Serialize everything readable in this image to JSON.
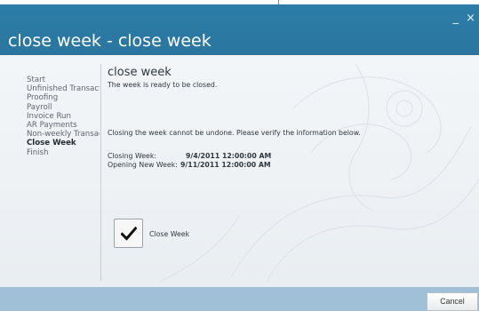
{
  "window": {
    "title": "close week - close week",
    "minimize_glyph": "_",
    "close_glyph": "×"
  },
  "nav": {
    "items": [
      {
        "label": "Start",
        "active": false
      },
      {
        "label": "Unfinished Transactions",
        "active": false
      },
      {
        "label": "Proofing",
        "active": false
      },
      {
        "label": "Payroll",
        "active": false
      },
      {
        "label": "Invoice Run",
        "active": false
      },
      {
        "label": "AR Payments",
        "active": false
      },
      {
        "label": "Non-weekly Transactions",
        "active": false
      },
      {
        "label": "Close Week",
        "active": true
      },
      {
        "label": "Finish",
        "active": false
      }
    ]
  },
  "content": {
    "heading": "close week",
    "ready_text": "The week is ready to be closed.",
    "warning_text": "Closing the week cannot be undone. Please verify the information below.",
    "closing_week_label": "Closing Week:",
    "closing_week_value": "9/4/2011 12:00:00 AM",
    "opening_week_label": "Opening New Week:",
    "opening_week_value": "9/11/2011 12:00:00 AM",
    "close_week_button_label": "Close Week"
  },
  "footer": {
    "cancel_label": "Cancel"
  },
  "icons": {
    "close_week_button": "checkmark-icon"
  },
  "colors": {
    "titlebar": "#2c7ea8",
    "footer": "#9fc0d6",
    "body": "#eef2f5"
  }
}
